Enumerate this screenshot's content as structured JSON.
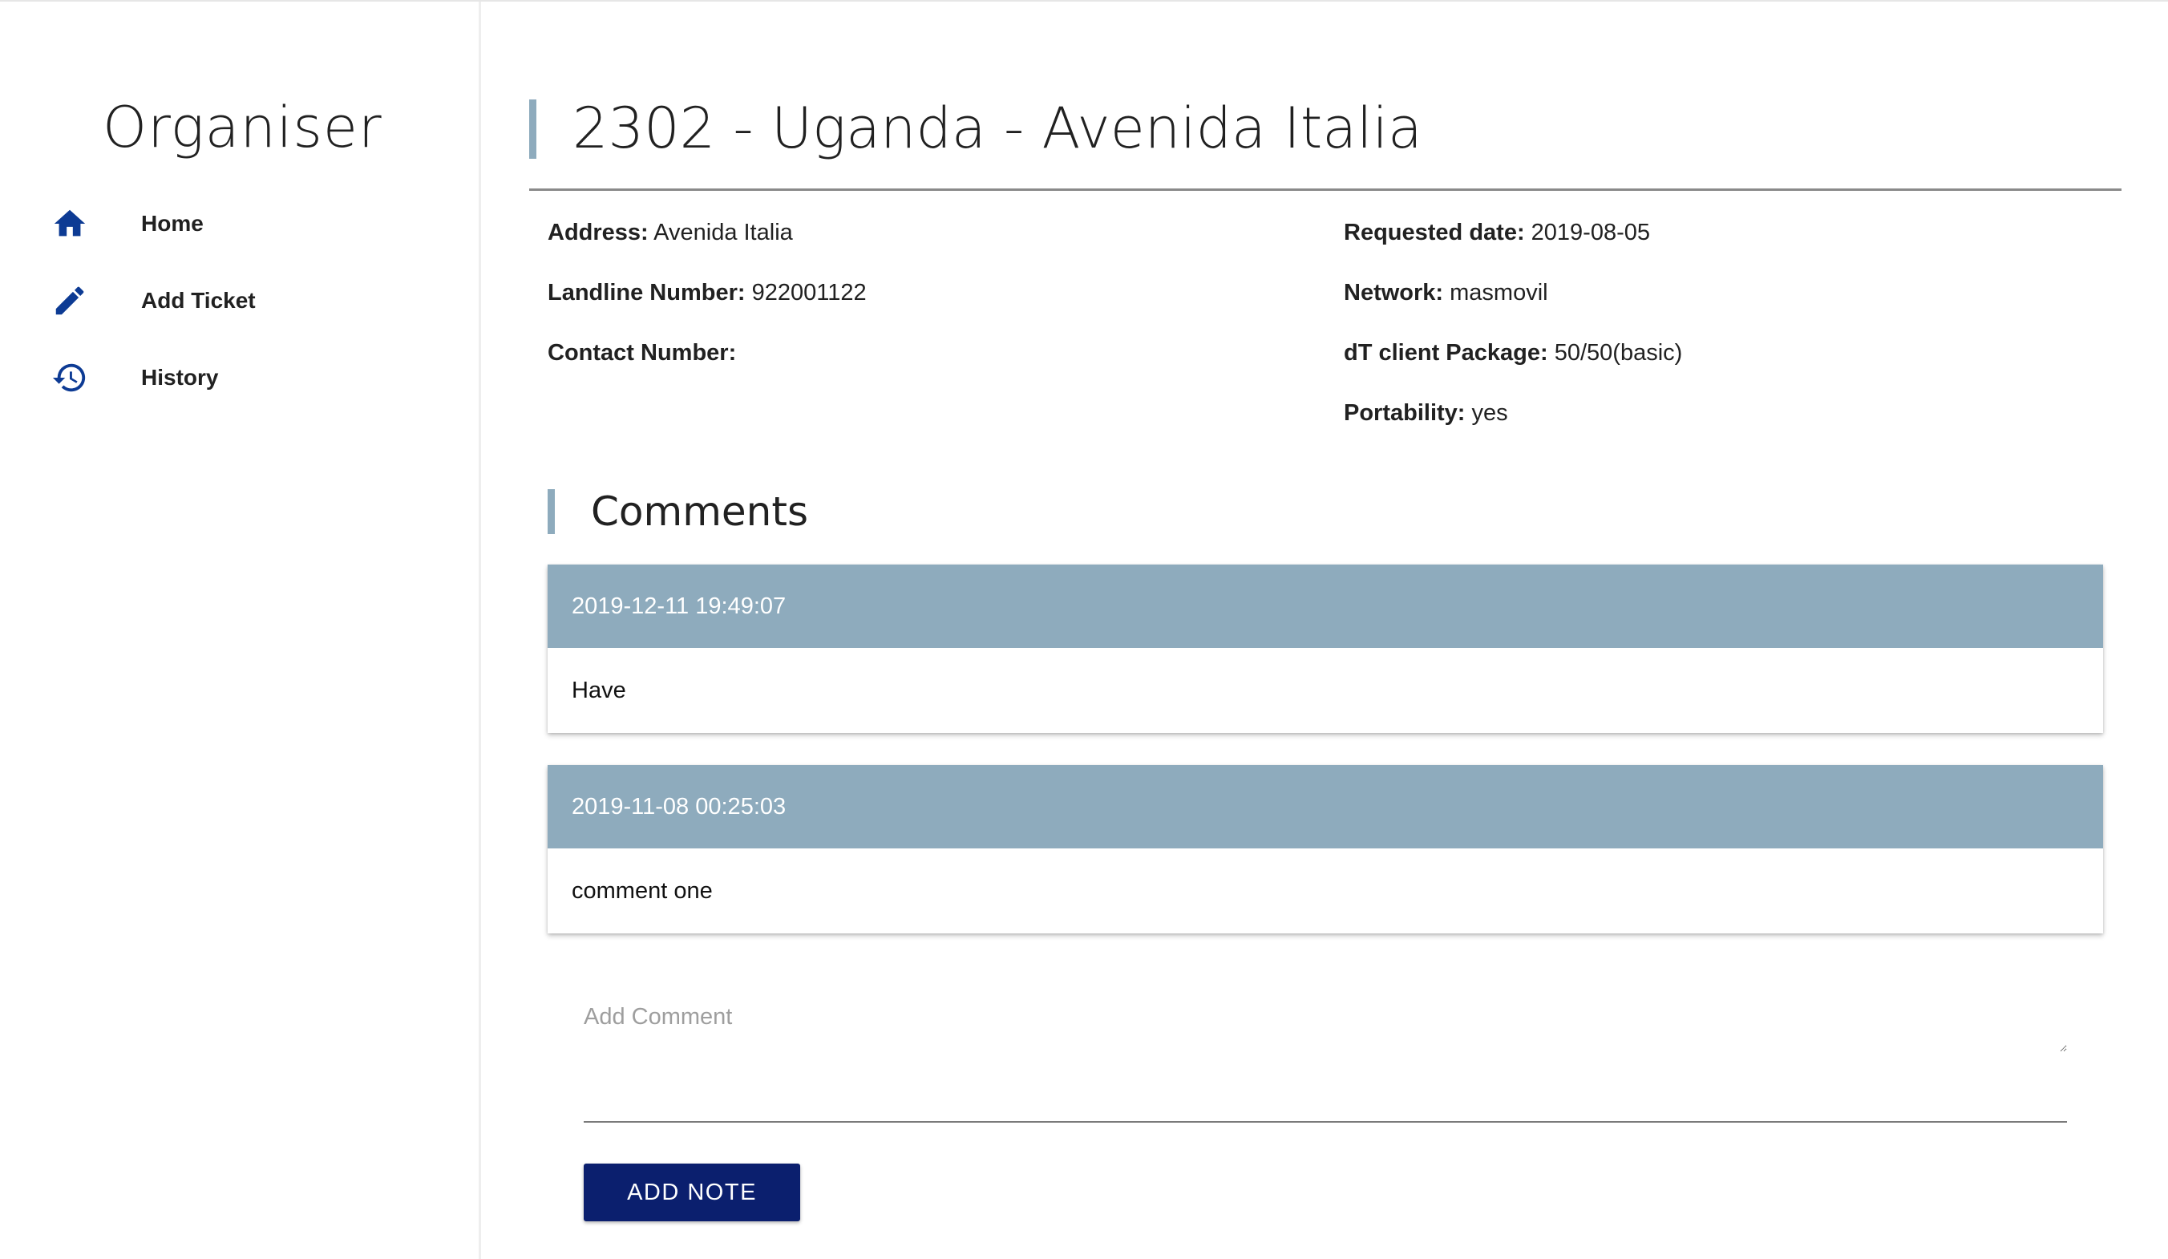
{
  "sidebar": {
    "brand": "Organiser",
    "items": [
      {
        "label": "Home",
        "icon": "home-icon"
      },
      {
        "label": "Add Ticket",
        "icon": "pencil-icon"
      },
      {
        "label": "History",
        "icon": "history-icon"
      }
    ]
  },
  "ticket": {
    "title": "2302 - Uganda - Avenida Italia",
    "left": [
      {
        "key": "Address:",
        "value": "Avenida Italia"
      },
      {
        "key": "Landline Number:",
        "value": "922001122"
      },
      {
        "key": "Contact Number:",
        "value": ""
      }
    ],
    "right": [
      {
        "key": "Requested date:",
        "value": "2019-08-05"
      },
      {
        "key": "Network:",
        "value": "masmovil"
      },
      {
        "key": "dT client Package:",
        "value": "50/50(basic)"
      },
      {
        "key": "Portability:",
        "value": "yes"
      }
    ]
  },
  "comments": {
    "title": "Comments",
    "items": [
      {
        "timestamp": "2019-12-11 19:49:07",
        "text": "Have"
      },
      {
        "timestamp": "2019-11-08 00:25:03",
        "text": "comment one"
      }
    ],
    "input_placeholder": "Add Comment",
    "input_value": "",
    "add_button": "ADD NOTE"
  },
  "colors": {
    "accent": "#0d3b94",
    "comment_header": "#8eabbd",
    "button": "#0b1f6e"
  }
}
